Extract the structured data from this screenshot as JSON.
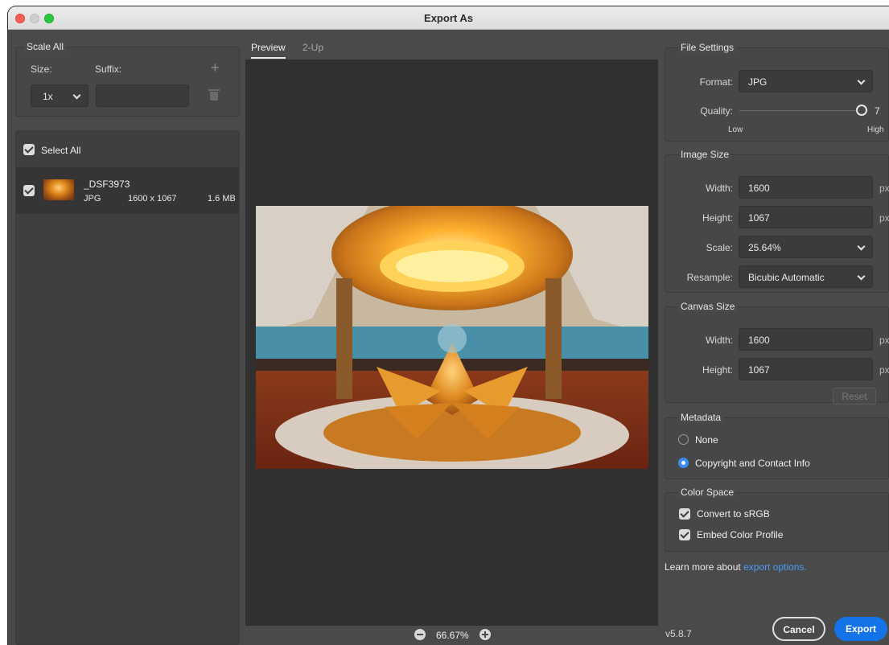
{
  "window": {
    "title": "Export As"
  },
  "scale_all": {
    "label": "Scale All",
    "size_label": "Size:",
    "suffix_label": "Suffix:",
    "size_value": "1x",
    "suffix_value": ""
  },
  "file_list": {
    "select_all_label": "Select All",
    "items": [
      {
        "name": "_DSF3973",
        "format": "JPG",
        "dimensions": "1600 x 1067",
        "size": "1.6 MB"
      }
    ]
  },
  "preview": {
    "tabs": [
      "Preview",
      "2-Up"
    ],
    "zoom": "66.67%"
  },
  "file_settings": {
    "label": "File Settings",
    "format_label": "Format:",
    "format_value": "JPG",
    "quality_label": "Quality:",
    "quality_value": "7",
    "quality_low": "Low",
    "quality_high": "High"
  },
  "image_size": {
    "label": "Image Size",
    "width_label": "Width:",
    "width_value": "1600",
    "height_label": "Height:",
    "height_value": "1067",
    "unit": "px",
    "scale_label": "Scale:",
    "scale_value": "25.64%",
    "resample_label": "Resample:",
    "resample_value": "Bicubic Automatic"
  },
  "canvas_size": {
    "label": "Canvas Size",
    "width_label": "Width:",
    "width_value": "1600",
    "height_label": "Height:",
    "height_value": "1067",
    "unit": "px",
    "reset_label": "Reset"
  },
  "metadata": {
    "label": "Metadata",
    "options": [
      "None",
      "Copyright and Contact Info"
    ],
    "selected": "Copyright and Contact Info"
  },
  "color_space": {
    "label": "Color Space",
    "convert_label": "Convert to sRGB",
    "embed_label": "Embed Color Profile"
  },
  "footer": {
    "learn_text": "Learn more about",
    "learn_link": "export options.",
    "version": "v5.8.7",
    "cancel_label": "Cancel",
    "export_label": "Export"
  },
  "colors": {
    "accent": "#1473e6",
    "link": "#4a9cf5",
    "panel": "#4a4a4a"
  }
}
